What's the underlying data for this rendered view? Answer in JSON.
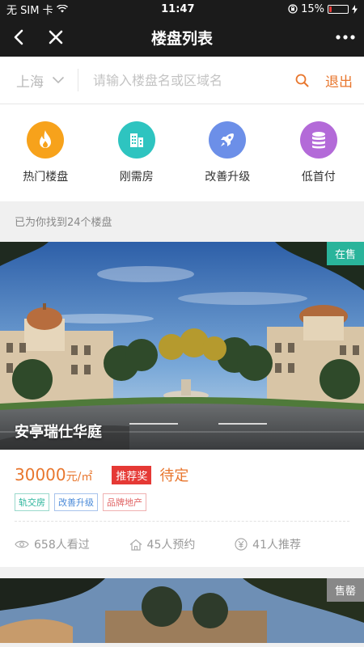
{
  "status_bar": {
    "carrier": "无 SIM 卡",
    "time": "11:47",
    "battery": "15%",
    "battery_level": 0.15,
    "battery_color": "#e53935"
  },
  "navbar": {
    "title": "楼盘列表",
    "back_icon": "chevron-left-icon",
    "close_icon": "close-icon",
    "more_icon": "more-dots-icon"
  },
  "search": {
    "city": "上海",
    "placeholder": "请输入楼盘名或区域名",
    "logout_label": "退出"
  },
  "categories": [
    {
      "label": "热门楼盘",
      "icon": "flame-icon",
      "color": "#f7a21b"
    },
    {
      "label": "刚需房",
      "icon": "building-icon",
      "color": "#2ec4c0"
    },
    {
      "label": "改善升级",
      "icon": "rocket-icon",
      "color": "#6c8fe8"
    },
    {
      "label": "低首付",
      "icon": "coins-icon",
      "color": "#b36ad8"
    }
  ],
  "result_count": "已为你找到24个楼盘",
  "listings": [
    {
      "status": "在售",
      "status_color": "#2ab49b",
      "name": "安亭瑞仕华庭",
      "price": "30000",
      "price_unit": "元/㎡",
      "award": "推荐奖",
      "award_value": "待定",
      "tags": [
        "轨交房",
        "改善升级",
        "品牌地产"
      ],
      "views": "658人看过",
      "appointments": "45人预约",
      "recommends": "41人推荐"
    },
    {
      "status": "售罄",
      "status_color": "#888888"
    }
  ],
  "accent_color": "#e8762d"
}
